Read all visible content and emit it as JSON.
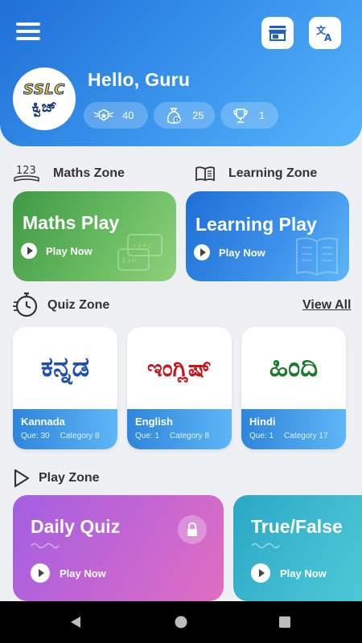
{
  "header": {
    "greeting": "Hello, Guru",
    "logo_top": "SSLC",
    "logo_bottom": "ಕ್ವಿಜ್",
    "stats": [
      {
        "icon": "rank-badge-icon",
        "value": "40"
      },
      {
        "icon": "coin-bag-icon",
        "value": "25"
      },
      {
        "icon": "trophy-icon",
        "value": "1"
      }
    ]
  },
  "sections": {
    "maths_zone": "Maths Zone",
    "learning_zone": "Learning Zone",
    "quiz_zone": "Quiz Zone",
    "view_all": "View All",
    "play_zone": "Play Zone"
  },
  "zone_cards": [
    {
      "title": "Maths Play",
      "action": "Play Now",
      "gradient": [
        "#3f9a46",
        "#8fd07a"
      ]
    },
    {
      "title": "Learning Play",
      "action": "Play Now",
      "gradient": [
        "#1f6fd6",
        "#5db6f6"
      ]
    }
  ],
  "quiz_languages": [
    {
      "script": "ಕನ್ನಡ",
      "name": "Kannada",
      "que": "Que: 30",
      "category": "Category 8",
      "color": "#1f4fae"
    },
    {
      "script": "ಇಂಗ್ಲಿಷ್",
      "name": "English",
      "que": "Que: 1",
      "category": "Category 8",
      "color": "#c4161c"
    },
    {
      "script": "ಹಿಂದಿ",
      "name": "Hindi",
      "que": "Que: 1",
      "category": "Category 17",
      "color": "#1c7a2c"
    }
  ],
  "play_zone_cards": [
    {
      "title": "Daily Quiz",
      "action": "Play Now",
      "locked": true
    },
    {
      "title": "True/False",
      "action": "Play Now",
      "locked": false
    }
  ],
  "colors": {
    "header_gradient": [
      "#1f6fd6",
      "#55b4fb"
    ],
    "daily_quiz_gradient": [
      "#a35fe0",
      "#e06ec0"
    ],
    "true_false_gradient": [
      "#2aa7c5",
      "#4cc9d6"
    ]
  }
}
